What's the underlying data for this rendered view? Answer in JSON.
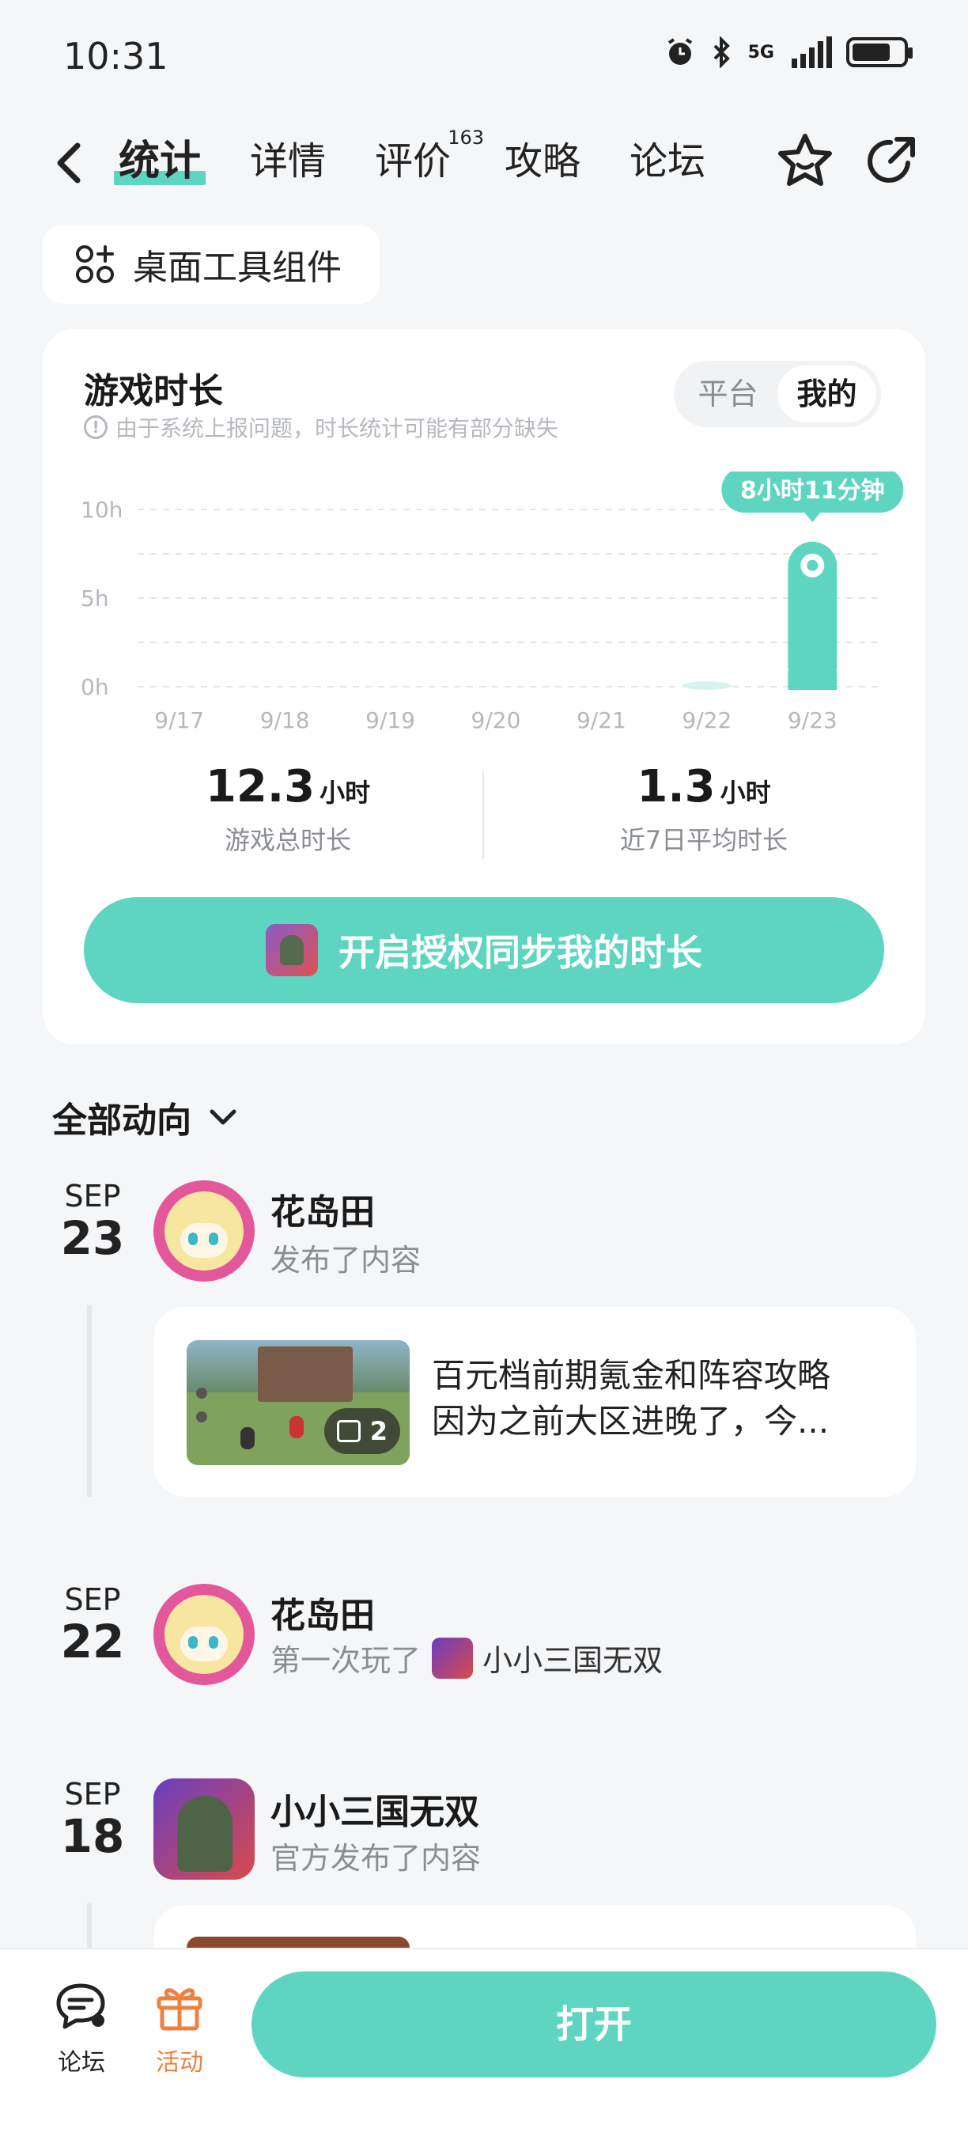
{
  "status_bar": {
    "time": "10:31",
    "network": "5G"
  },
  "header": {
    "tabs": [
      {
        "label": "统计",
        "active": true
      },
      {
        "label": "详情"
      },
      {
        "label": "评价",
        "badge": "163"
      },
      {
        "label": "攻略"
      },
      {
        "label": "论坛"
      }
    ]
  },
  "widget": {
    "label": "桌面工具组件"
  },
  "stats": {
    "title": "游戏时长",
    "note": "由于系统上报问题，时长统计可能有部分缺失",
    "toggle": {
      "options": [
        "平台",
        "我的"
      ],
      "selected": "我的"
    },
    "tooltip": "8小时11分钟",
    "total": {
      "value": "12.3",
      "unit": "小时",
      "caption": "游戏总时长"
    },
    "average": {
      "value": "1.3",
      "unit": "小时",
      "caption": "近7日平均时长"
    },
    "auth_button": "开启授权同步我的时长"
  },
  "chart_data": {
    "type": "bar",
    "categories": [
      "9/17",
      "9/18",
      "9/19",
      "9/20",
      "9/21",
      "9/22",
      "9/23"
    ],
    "values": [
      0,
      0,
      0,
      0,
      0,
      0.3,
      8.18
    ],
    "yticks": [
      "10h",
      "5h",
      "0h"
    ],
    "ylim": [
      0,
      10
    ],
    "grid": true,
    "highlight_index": 6,
    "color": "#5ed5c1",
    "muted_color": "#d6f4ef"
  },
  "feed": {
    "title": "全部动向",
    "items": [
      {
        "month": "SEP",
        "day": "23",
        "name": "花岛田",
        "action": "发布了内容",
        "post": {
          "line1": "百元档前期氪金和阵容攻略",
          "line2": "因为之前大区进晚了，今...",
          "image_count": "2"
        }
      },
      {
        "month": "SEP",
        "day": "22",
        "name": "花岛田",
        "action": "第一次玩了",
        "game": "小小三国无双"
      },
      {
        "month": "SEP",
        "day": "18",
        "name": "小小三国无双",
        "action": "官方发布了内容"
      }
    ]
  },
  "bottom_bar": {
    "forum_label": "论坛",
    "event_label": "活动",
    "open_button": "打开",
    "accent": "#f08040"
  }
}
